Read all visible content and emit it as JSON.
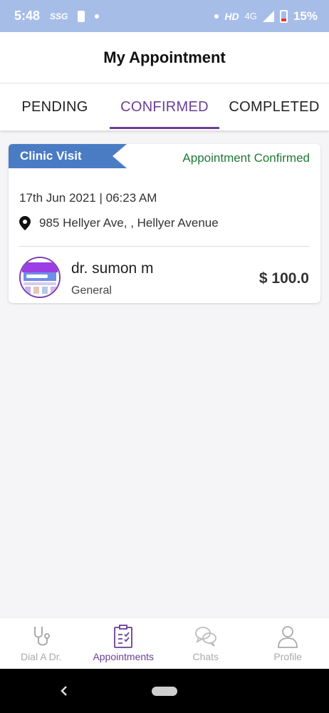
{
  "status_bar": {
    "time": "5:48",
    "carrier_icon": "SSG",
    "network_hd": "HD",
    "network_type": "4G",
    "battery": "15%"
  },
  "header": {
    "title": "My Appointment"
  },
  "tabs": [
    {
      "label": "PENDING",
      "active": false
    },
    {
      "label": "CONFIRMED",
      "active": true
    },
    {
      "label": "COMPLETED",
      "active": false
    }
  ],
  "appointment": {
    "visit_type": "Clinic Visit",
    "status": "Appointment Confirmed",
    "datetime": "17th Jun 2021 | 06:23 AM",
    "address": "985 Hellyer Ave, , Hellyer Avenue",
    "doctor_name": "dr. sumon m",
    "specialty": "General",
    "price": "$ 100.0"
  },
  "colors": {
    "accent": "#6a3f96",
    "badge": "#4a7cc4",
    "confirmed": "#1f7a35",
    "status_bar": "#a6bde8"
  },
  "bottom_nav": [
    {
      "label": "Dial A Dr.",
      "icon": "stethoscope-icon",
      "active": false
    },
    {
      "label": "Appointments",
      "icon": "clipboard-icon",
      "active": true
    },
    {
      "label": "Chats",
      "icon": "chat-icon",
      "active": false
    },
    {
      "label": "Profile",
      "icon": "person-icon",
      "active": false
    }
  ]
}
